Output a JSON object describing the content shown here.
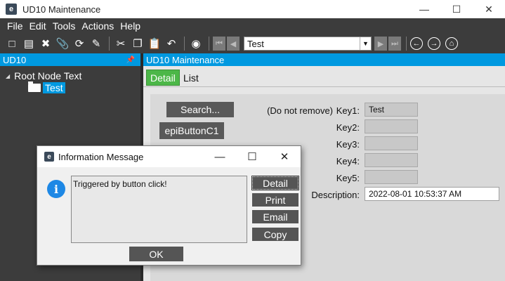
{
  "window": {
    "title": "UD10 Maintenance",
    "logo": "e",
    "controls": [
      "minimize-icon",
      "maximize-icon",
      "close-icon"
    ]
  },
  "menu": [
    "File",
    "Edit",
    "Tools",
    "Actions",
    "Help"
  ],
  "toolbar": {
    "icons": [
      "new-icon",
      "save-icon",
      "delete-icon",
      "attach-icon",
      "refresh-icon",
      "clear-icon",
      "cut-icon",
      "copy-icon",
      "paste-icon",
      "undo-icon",
      "search-binoculars-icon"
    ],
    "navigation_icons": [
      "first-record-icon",
      "previous-record-icon",
      "next-record-icon",
      "last-record-icon"
    ],
    "combo_value": "Test",
    "right_icons": [
      "back-icon",
      "forward-icon",
      "home-icon"
    ]
  },
  "tree": {
    "header": "UD10",
    "root_label": "Root Node Text",
    "child_label": "Test"
  },
  "main": {
    "header": "UD10 Maintenance",
    "tabs": [
      "Detail",
      "List"
    ],
    "search_button": "Search...",
    "epi_button": "epiButtonC1",
    "key1_label_prefix": "(Do not remove)",
    "fields": [
      {
        "label": "Key1:",
        "value": "Test"
      },
      {
        "label": "Key2:",
        "value": ""
      },
      {
        "label": "Key3:",
        "value": ""
      },
      {
        "label": "Key4:",
        "value": ""
      },
      {
        "label": "Key5:",
        "value": ""
      }
    ],
    "description_label": "Description:",
    "description_value": "2022-08-01 10:53:37 AM"
  },
  "dialog": {
    "title": "Information Message",
    "message": "Triggered by button click!",
    "side_buttons": [
      "Detail",
      "Print",
      "Email",
      "Copy"
    ],
    "ok_label": "OK",
    "controls": [
      "minimize-icon",
      "maximize-icon",
      "close-icon"
    ]
  },
  "colors": {
    "accent_blue": "#0099e0",
    "tab_active_green": "#4cb748",
    "dark_chrome": "#3c3c3c",
    "button_dark": "#595959"
  }
}
